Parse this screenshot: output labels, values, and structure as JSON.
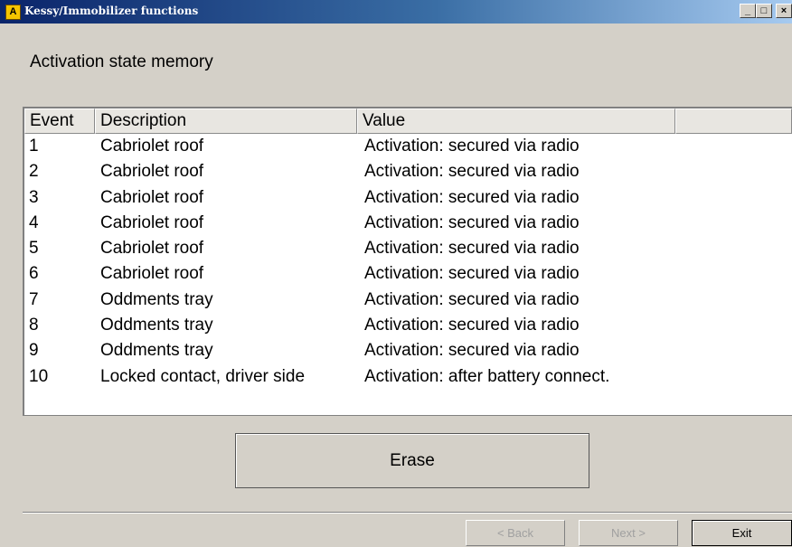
{
  "window": {
    "app_icon_letter": "A",
    "title": "Kessy/Immobilizer functions",
    "minimize_label": "_",
    "maximize_label": "□",
    "close_label": "×"
  },
  "heading": "Activation state memory",
  "table": {
    "columns": [
      "Event",
      "Description",
      "Value",
      ""
    ],
    "rows": [
      {
        "event": "1",
        "description": "Cabriolet roof",
        "value": "Activation: secured via radio"
      },
      {
        "event": "2",
        "description": "Cabriolet roof",
        "value": "Activation: secured via radio"
      },
      {
        "event": "3",
        "description": "Cabriolet roof",
        "value": "Activation: secured via radio"
      },
      {
        "event": "4",
        "description": "Cabriolet roof",
        "value": "Activation: secured via radio"
      },
      {
        "event": "5",
        "description": "Cabriolet roof",
        "value": "Activation: secured via radio"
      },
      {
        "event": "6",
        "description": "Cabriolet roof",
        "value": "Activation: secured via radio"
      },
      {
        "event": "7",
        "description": "Oddments tray",
        "value": "Activation: secured via radio"
      },
      {
        "event": "8",
        "description": "Oddments tray",
        "value": "Activation: secured via radio"
      },
      {
        "event": "9",
        "description": "Oddments tray",
        "value": "Activation: secured via radio"
      },
      {
        "event": "10",
        "description": "Locked contact, driver side",
        "value": "Activation: after battery connect."
      }
    ]
  },
  "buttons": {
    "erase": "Erase",
    "back": "< Back",
    "next": "Next >",
    "exit": "Exit"
  }
}
